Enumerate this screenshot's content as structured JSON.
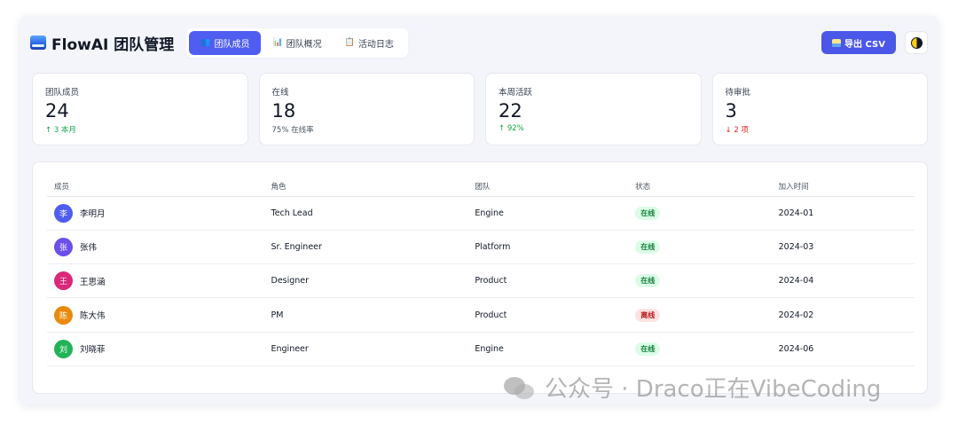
{
  "app": {
    "title": "FlowAI 团队管理",
    "logo": "wave-logo-icon"
  },
  "tabs": [
    {
      "label": "团队成员",
      "icon": "people-icon",
      "active": true
    },
    {
      "label": "团队概况",
      "icon": "bar-chart-icon",
      "active": false
    },
    {
      "label": "活动日志",
      "icon": "clipboard-icon",
      "active": false
    }
  ],
  "actions": {
    "export_label": "导出 CSV",
    "theme_icon": "half-moon-icon"
  },
  "stats": [
    {
      "label": "团队成员",
      "value": "24",
      "sub": "↑ 3 本月",
      "trend": "up"
    },
    {
      "label": "在线",
      "value": "18",
      "sub": "75% 在线率",
      "trend": "neutral"
    },
    {
      "label": "本周活跃",
      "value": "22",
      "sub": "↑ 92%",
      "trend": "up"
    },
    {
      "label": "待审批",
      "value": "3",
      "sub": "↓ 2 项",
      "trend": "down"
    }
  ],
  "table": {
    "headers": [
      "成员",
      "角色",
      "团队",
      "状态",
      "加入时间"
    ],
    "rows": [
      {
        "initial": "李",
        "avatar_color": "#4f5df0",
        "name": "李明月",
        "role": "Tech Lead",
        "team": "Engine",
        "status": "在线",
        "status_type": "online",
        "joined": "2024-01"
      },
      {
        "initial": "张",
        "avatar_color": "#6d4ee8",
        "name": "张伟",
        "role": "Sr. Engineer",
        "team": "Platform",
        "status": "在线",
        "status_type": "online",
        "joined": "2024-03"
      },
      {
        "initial": "王",
        "avatar_color": "#db2777",
        "name": "王思涵",
        "role": "Designer",
        "team": "Product",
        "status": "在线",
        "status_type": "online",
        "joined": "2024-04"
      },
      {
        "initial": "陈",
        "avatar_color": "#ea8a0c",
        "name": "陈大伟",
        "role": "PM",
        "team": "Product",
        "status": "离线",
        "status_type": "offline",
        "joined": "2024-02"
      },
      {
        "initial": "刘",
        "avatar_color": "#22b357",
        "name": "刘晓菲",
        "role": "Engineer",
        "team": "Engine",
        "status": "在线",
        "status_type": "online",
        "joined": "2024-06"
      }
    ]
  },
  "watermark": {
    "text": "公众号 · Draco正在VibeCoding",
    "icon": "wechat-icon"
  }
}
